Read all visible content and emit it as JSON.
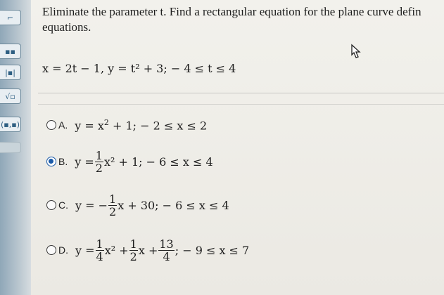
{
  "sidebar": {
    "tools": [
      {
        "icon": "template-icon",
        "label": "⌐"
      },
      {
        "icon": "fraction-icon",
        "label": "▪▪"
      },
      {
        "icon": "absolute-value-icon",
        "label": "|▪|"
      },
      {
        "icon": "sqrt-icon",
        "label": "√▫"
      },
      {
        "icon": "interval-icon",
        "label": "(▪,▪)"
      },
      {
        "icon": "more-icon",
        "label": ""
      }
    ]
  },
  "question": {
    "line1": "Eliminate the parameter t. Find a rectangular equation for the plane curve defin",
    "line2": "equations.",
    "equation": "x = 2t − 1, y = t² + 3; − 4 ≤ t ≤ 4"
  },
  "options": [
    {
      "letter": "A.",
      "selected": false,
      "pre": "y = x",
      "sup": "2",
      "post": " + 1; − 2 ≤ x ≤ 2"
    },
    {
      "letter": "B.",
      "selected": true,
      "pre": "y = ",
      "frac": {
        "num": "1",
        "den": "2"
      },
      "post": "x² + 1; − 6 ≤ x ≤ 4"
    },
    {
      "letter": "C.",
      "selected": false,
      "pre": "y = − ",
      "frac": {
        "num": "1",
        "den": "2"
      },
      "post": "x + 30; − 6 ≤ x ≤ 4"
    },
    {
      "letter": "D.",
      "selected": false,
      "pre": "y = ",
      "frac": {
        "num": "1",
        "den": "4"
      },
      "mid1": "x² + ",
      "frac2": {
        "num": "1",
        "den": "2"
      },
      "mid2": "x + ",
      "frac3": {
        "num": "13",
        "den": "4"
      },
      "post": "; − 9 ≤ x ≤ 7"
    }
  ]
}
